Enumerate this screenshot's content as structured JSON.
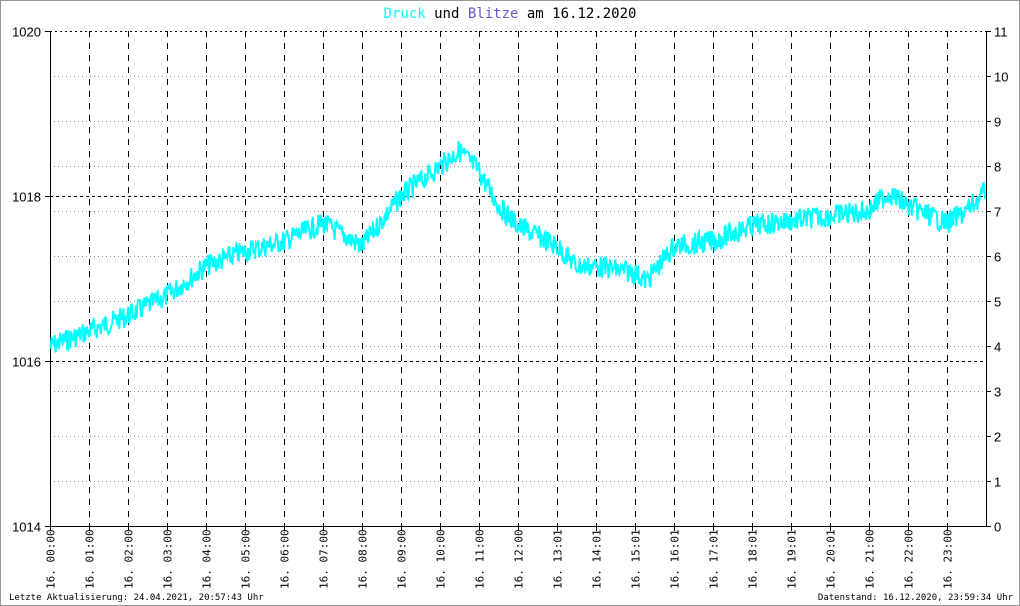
{
  "chart_data": {
    "type": "line",
    "title": {
      "part1": "Druck",
      "part2": "und",
      "part3": "Blitze",
      "part4": "am 16.12.2020"
    },
    "colors": {
      "druck": "#00ffff",
      "blitze": "#6a5acd",
      "grid": "#000000"
    },
    "y_left": {
      "range": [
        1014,
        1020
      ],
      "ticks": [
        "1014",
        "1016",
        "1018",
        "1020"
      ]
    },
    "y_right": {
      "range": [
        0,
        11
      ],
      "ticks": [
        "0",
        "1",
        "2",
        "3",
        "4",
        "5",
        "6",
        "7",
        "8",
        "9",
        "10",
        "11"
      ]
    },
    "x_range_hours": [
      0,
      24
    ],
    "x_ticks": [
      "16. 00:00",
      "16. 01:00",
      "16. 02:00",
      "16. 03:00",
      "16. 04:00",
      "16. 05:00",
      "16. 06:00",
      "16. 07:00",
      "16. 08:00",
      "16. 09:00",
      "16. 10:00",
      "16. 11:00",
      "16. 12:00",
      "16. 13:01",
      "16. 14:01",
      "16. 15:01",
      "16. 16:01",
      "16. 17:01",
      "16. 18:01",
      "16. 19:01",
      "16. 20:01",
      "16. 21:00",
      "16. 22:00",
      "16. 23:00"
    ],
    "series": [
      {
        "name": "Druck",
        "axis": "left",
        "x": [
          0,
          1,
          2,
          3,
          4,
          5,
          6,
          7,
          8,
          9,
          10,
          10.5,
          11,
          11.5,
          12,
          13,
          13.5,
          14,
          15,
          15.3,
          16,
          17,
          18,
          19,
          20,
          21,
          21.5,
          22,
          23,
          23.5,
          24
        ],
        "y": [
          1016.18,
          1016.36,
          1016.55,
          1016.79,
          1017.15,
          1017.33,
          1017.45,
          1017.67,
          1017.39,
          1018.0,
          1018.36,
          1018.55,
          1018.3,
          1017.88,
          1017.64,
          1017.39,
          1017.15,
          1017.15,
          1017.07,
          1016.97,
          1017.39,
          1017.45,
          1017.64,
          1017.7,
          1017.76,
          1017.82,
          1018.04,
          1017.88,
          1017.67,
          1017.82,
          1018.06
        ]
      },
      {
        "name": "Blitze",
        "axis": "right",
        "x": [],
        "y": []
      }
    ]
  },
  "footer": {
    "left": "Letzte Aktualisierung: 24.04.2021, 20:57:43 Uhr",
    "right": "Datenstand: 16.12.2020, 23:59:34 Uhr"
  }
}
